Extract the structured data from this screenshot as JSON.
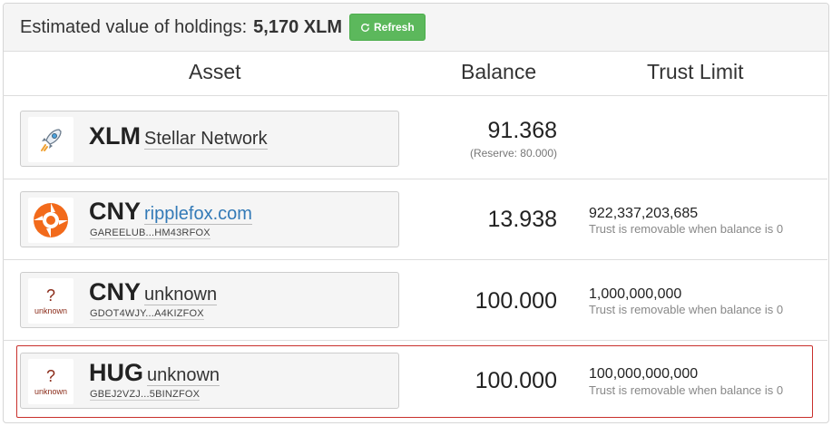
{
  "header": {
    "estimate_label": "Estimated value of holdings:",
    "estimate_value": "5,170 XLM",
    "refresh_label": "Refresh"
  },
  "columns": {
    "asset": "Asset",
    "balance": "Balance",
    "trust": "Trust Limit"
  },
  "rows": [
    {
      "code": "XLM",
      "issuer_name": "Stellar Network",
      "balance": "91.368",
      "reserve": "(Reserve: 80.000)",
      "logo": "rocket-icon"
    },
    {
      "code": "CNY",
      "issuer_name": "ripplefox.com",
      "issuer_id": "GAREELUB...HM43RFOX",
      "balance": "13.938",
      "trust_limit": "922,337,203,685",
      "trust_note": "Trust is removable when balance is 0",
      "logo": "ripplefox-icon",
      "link_color": "#337ab7"
    },
    {
      "code": "CNY",
      "issuer_name": "unknown",
      "issuer_id": "GDOT4WJY...A4KIZFOX",
      "balance": "100.000",
      "trust_limit": "1,000,000,000",
      "trust_note": "Trust is removable when balance is 0",
      "logo_q": "?",
      "logo_text": "unknown"
    },
    {
      "code": "HUG",
      "issuer_name": "unknown",
      "issuer_id": "GBEJ2VZJ...5BINZFOX",
      "balance": "100.000",
      "trust_limit": "100,000,000,000",
      "trust_note": "Trust is removable when balance is 0",
      "logo_q": "?",
      "logo_text": "unknown",
      "highlight_color": "#c9302c"
    }
  ],
  "colors": {
    "refresh_button": "#5cb85c",
    "header_bg": "#f5f5f5"
  }
}
